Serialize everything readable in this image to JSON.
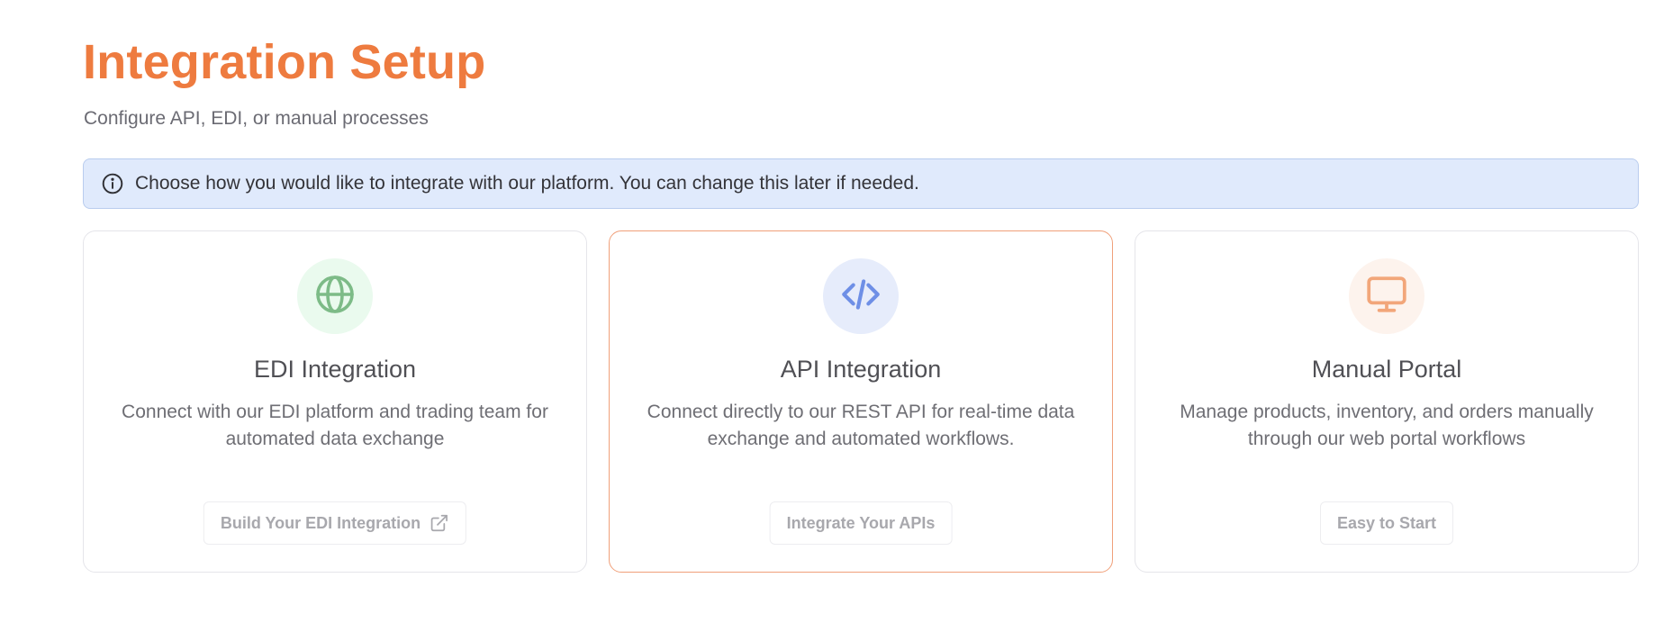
{
  "header": {
    "title": "Integration Setup",
    "subtitle": "Configure API, EDI, or manual processes"
  },
  "info_banner": {
    "icon": "info-circle-icon",
    "text": "Choose how you would like to integrate with our platform. You can change this later if needed."
  },
  "cards": [
    {
      "icon": "globe-icon",
      "title": "EDI Integration",
      "description": "Connect with our EDI platform and trading team for automated data exchange",
      "button_label": "Build Your EDI Integration",
      "button_icon": "external-link-icon",
      "selected": false,
      "icon_color": "#7dbb87",
      "icon_bg": "#eafaee"
    },
    {
      "icon": "code-icon",
      "title": "API Integration",
      "description": "Connect directly to our REST API for real-time data exchange and automated workflows.",
      "button_label": "Integrate Your APIs",
      "selected": true,
      "icon_color": "#6e8fe6",
      "icon_bg": "#e6ecfb"
    },
    {
      "icon": "monitor-icon",
      "title": "Manual Portal",
      "description": "Manage products, inventory, and orders manually through our web portal workflows",
      "button_label": "Easy to Start",
      "selected": false,
      "icon_color": "#f2a67a",
      "icon_bg": "#fdf3ed"
    }
  ],
  "colors": {
    "accent": "#ee7b3f",
    "banner_bg": "#e0eafc",
    "banner_border": "#b9ccee",
    "selected_border": "#f0a07a"
  }
}
